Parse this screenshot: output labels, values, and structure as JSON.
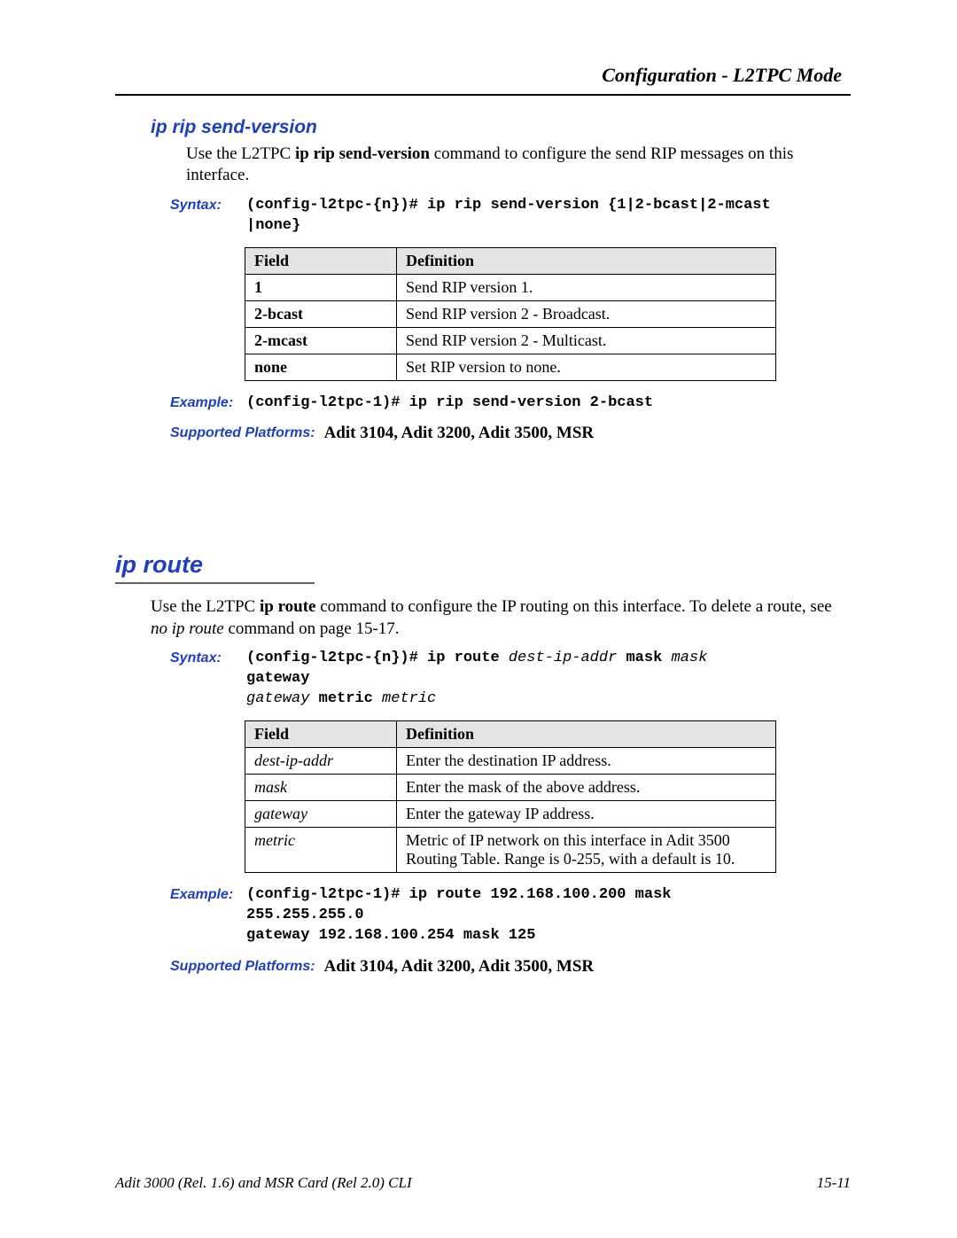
{
  "header": {
    "chapter": "Configuration - L2TPC Mode"
  },
  "section1": {
    "title": "ip rip send-version",
    "intro_prefix": "Use the L2TPC ",
    "intro_cmd": "ip rip send-version",
    "intro_suffix": " command to configure the send RIP messages on this interface.",
    "syntax_label": "Syntax:",
    "syntax_line1": "(config-l2tpc-{n})# ip rip send-version {1|2-bcast|2-mcast",
    "syntax_line2": "|none}",
    "table": {
      "headers": {
        "field": "Field",
        "definition": "Definition"
      },
      "rows": [
        {
          "field": "1",
          "definition": "Send RIP version 1."
        },
        {
          "field": "2-bcast",
          "definition": "Send RIP version 2 - Broadcast."
        },
        {
          "field": "2-mcast",
          "definition": "Send RIP version 2 - Multicast."
        },
        {
          "field": "none",
          "definition": "Set RIP version to none."
        }
      ]
    },
    "example_label": "Example:",
    "example_text": "(config-l2tpc-1)# ip rip send-version 2-bcast",
    "platforms_label": "Supported Platforms:",
    "platforms_value": "Adit 3104, Adit 3200, Adit 3500, MSR"
  },
  "section2": {
    "title": "ip route",
    "intro_prefix": "Use the L2TPC ",
    "intro_cmd": "ip route",
    "intro_mid": " command to configure the IP routing on this interface. To delete a route, see ",
    "intro_italic": "no ip route",
    "intro_suffix": " command on page 15-17.",
    "syntax_label": "Syntax:",
    "syntax": {
      "p1": "(config-l2tpc-{n})# ip route ",
      "a1": "dest-ip-addr",
      "p2": " mask ",
      "a2": "mask",
      "p3": " gateway ",
      "a3": "gateway",
      "p4": " metric ",
      "a4": "metric"
    },
    "table": {
      "headers": {
        "field": "Field",
        "definition": "Definition"
      },
      "rows": [
        {
          "field": "dest-ip-addr",
          "definition": "Enter the destination IP address."
        },
        {
          "field": "mask",
          "definition": "Enter the mask of the above address."
        },
        {
          "field": "gateway",
          "definition": "Enter the gateway IP address."
        },
        {
          "field": "metric",
          "definition": "Metric of IP network on this interface in Adit 3500 Routing Table. Range is 0-255, with a default is 10."
        }
      ]
    },
    "example_label": "Example:",
    "example_line1": "(config-l2tpc-1)# ip route 192.168.100.200 mask 255.255.255.0",
    "example_line2": "gateway 192.168.100.254 mask 125",
    "platforms_label": "Supported Platforms:",
    "platforms_value": "Adit 3104, Adit 3200, Adit 3500, MSR"
  },
  "footer": {
    "left": "Adit 3000 (Rel. 1.6) and MSR Card (Rel 2.0) CLI",
    "right": "15-11"
  }
}
